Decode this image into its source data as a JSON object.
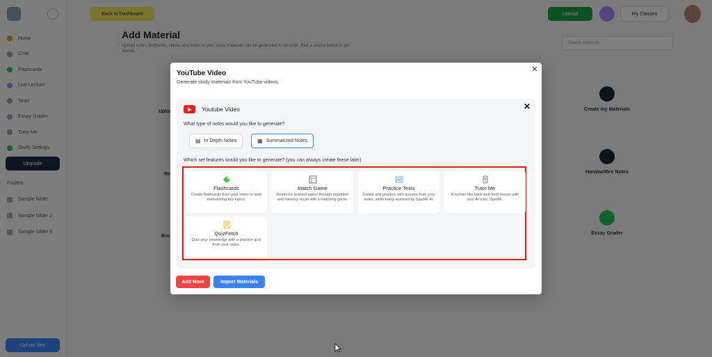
{
  "background": {
    "nav_items": [
      {
        "label": "Home",
        "color": "#f59e0b"
      },
      {
        "label": "Chat",
        "color": "#9ca3af"
      },
      {
        "label": "Flashcards",
        "color": "#22c55e"
      },
      {
        "label": "Live Lecture",
        "color": "#a78bfa"
      },
      {
        "label": "Tests",
        "color": "#9ca3af"
      },
      {
        "label": "Essay Grader",
        "color": "#9ca3af"
      },
      {
        "label": "Tutor Me",
        "color": "#9ca3af"
      },
      {
        "label": "Study Settings",
        "color": "#22c55e"
      }
    ],
    "upgrade_label": "Upgrade",
    "section_label": "Folders",
    "folders": [
      "Sample folder",
      "Sample folder 2",
      "Sample folder 3"
    ],
    "bottom_button": "Upload files",
    "back_button": "Back to Dashboard",
    "upload_button": "Upload",
    "class_button": "My Classes",
    "page_title": "Add Material",
    "page_desc": "Upload notes, textbooks, videos and more so your study materials can be generated in seconds. Pick a source below to get started.",
    "search_placeholder": "Search materials",
    "right_cards": [
      "Create my Materials",
      "Handwritten Notes",
      "Essay Grader"
    ],
    "left_labels": [
      "Upload",
      "Record",
      "Bro"
    ]
  },
  "modal": {
    "title": "YouTube Video",
    "subtitle": "Generate study materials from YouTube videos.",
    "panel_title": "Youtube Video",
    "notes_question": "What type of notes would you like to generate?",
    "note_options": [
      {
        "label": "In Depth Notes",
        "icon": "book-open-icon",
        "selected": false
      },
      {
        "label": "Summarized Notes",
        "icon": "document-icon",
        "selected": true
      }
    ],
    "features_question": "Which set features would you like to generate? (you can always create these later)",
    "features": [
      {
        "name": "Flashcards",
        "desc": "Create flashcards from your notes to start memorizing key topics.",
        "icon": "cards-icon",
        "color": "#22c55e"
      },
      {
        "name": "Match Game",
        "desc": "Reinforce learned topics through repetition and memory recall with a matching game.",
        "icon": "grid-icon",
        "color": "#6b7280"
      },
      {
        "name": "Practice Tests",
        "desc": "Create and practice with quizzes from your notes, while being assisted by SparkE AI.",
        "icon": "test-icon",
        "color": "#60a5fa"
      },
      {
        "name": "Tutor Me",
        "desc": "A human-like back-and-forth lesson with your AI tutor, SparkE.",
        "icon": "tutor-icon",
        "color": "#6b7280"
      },
      {
        "name": "QuizFetch",
        "desc": "Quiz your knowledge with a practice quiz from your notes.",
        "icon": "quiz-icon",
        "color": "#f59e0b"
      }
    ],
    "add_more_label": "Add More",
    "import_label": "Import Materials"
  },
  "colors": {
    "highlight": "#dc1a1a",
    "youtube_red": "#e02424",
    "primary_blue": "#3b82f6",
    "danger_red": "#ef4444"
  }
}
